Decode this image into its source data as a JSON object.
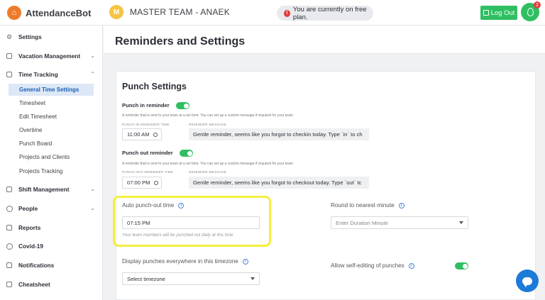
{
  "brand": {
    "name": "AttendanceBot",
    "logo_icon": "house-icon",
    "logo_color": "#ee7b2b"
  },
  "team": {
    "initial": "M",
    "name": "MASTER TEAM - ANAEK"
  },
  "plan_notice": {
    "text": "You are currently on free plan.",
    "icon": "alert-icon"
  },
  "logout_label": "Log Out",
  "notifications": {
    "count": "2",
    "icon": "drop-icon"
  },
  "sidebar": {
    "settings": "Settings",
    "vacation": "Vacation Management",
    "time_tracking": "Time Tracking",
    "time_tracking_sub": [
      "General Time Settings",
      "Timesheet",
      "Edit Timesheet",
      "Overtime",
      "Punch Board",
      "Projects and Clients",
      "Projects Tracking"
    ],
    "shift": "Shift Management",
    "people": "People",
    "reports": "Reports",
    "covid": "Covid-19",
    "notifications": "Notifications",
    "cheatsheet": "Cheatsheet"
  },
  "page": {
    "title": "Reminders and Settings"
  },
  "punch_settings": {
    "title": "Punch Settings",
    "punch_in": {
      "label": "Punch in reminder",
      "enabled": true,
      "help": "A reminder that is sent to your team at a set time. You can set up a custom message if required for your team",
      "time_caption": "PUNCH IN REMINDER TIME",
      "time": "11:00 AM",
      "message_caption": "REMINDER MESSAGE",
      "message": "Gentle reminder, seems like you forgot to checkin today. Type `in` to ch"
    },
    "punch_out": {
      "label": "Punch out reminder",
      "enabled": true,
      "help": "A reminder that is sent to your team at a set time. You can set up a custom message if required for your team",
      "time_caption": "PUNCH OUT REMINDER TIME",
      "time": "07:00 PM",
      "message_caption": "REMINDER MESSAGE",
      "message": "Gentle reminder, seems like you forgot to checkout today. Type `out` tc"
    },
    "auto_punch_out": {
      "label": "Auto punch-out time",
      "value": "07:15 PM",
      "note": "Your team members will be punched out daily at this time"
    },
    "round_minute": {
      "label": "Round to nearest minute",
      "placeholder": "Enter Duration Minute"
    },
    "timezone": {
      "label": "Display punches everywhere in this timezone",
      "value": "Select timezone"
    },
    "self_edit": {
      "label": "Allow self-editing of punches",
      "enabled": true
    }
  },
  "colors": {
    "accent_green": "#2fbf62",
    "active_blue": "#1a5fb4",
    "highlight_yellow": "#f4ef3e",
    "chat_blue": "#1c7ad8"
  }
}
